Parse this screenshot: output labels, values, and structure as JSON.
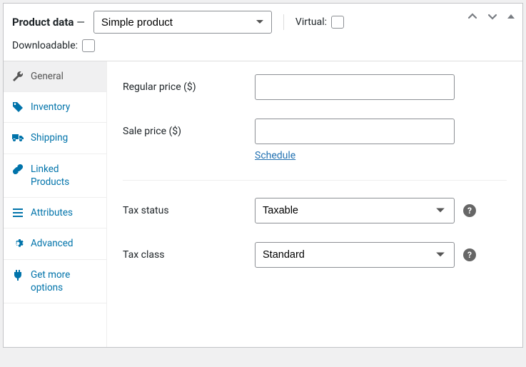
{
  "header": {
    "title": "Product data",
    "dash": "—",
    "product_type": "Simple product",
    "virtual_label": "Virtual:",
    "downloadable_label": "Downloadable:"
  },
  "tabs": [
    {
      "label": "General"
    },
    {
      "label": "Inventory"
    },
    {
      "label": "Shipping"
    },
    {
      "label": "Linked Products"
    },
    {
      "label": "Attributes"
    },
    {
      "label": "Advanced"
    },
    {
      "label": "Get more options"
    }
  ],
  "form": {
    "regular_price_label": "Regular price ($)",
    "sale_price_label": "Sale price ($)",
    "schedule_link": "Schedule",
    "tax_status_label": "Tax status",
    "tax_status_value": "Taxable",
    "tax_class_label": "Tax class",
    "tax_class_value": "Standard",
    "help_glyph": "?"
  }
}
